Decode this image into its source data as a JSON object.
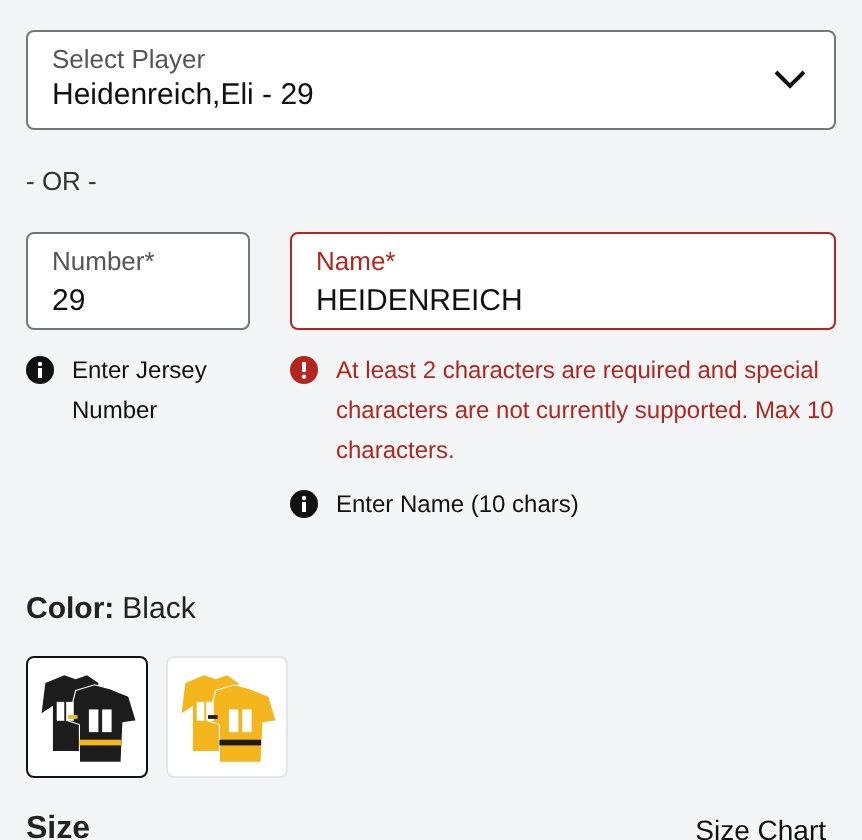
{
  "player_select": {
    "label": "Select Player",
    "value": "Heidenreich,Eli - 29"
  },
  "separator": "- OR -",
  "number_field": {
    "label": "Number*",
    "value": "29",
    "error": false,
    "hint": "Enter Jersey Number"
  },
  "name_field": {
    "label": "Name*",
    "value": "HEIDENREICH",
    "error": true,
    "error_message": "At least 2 characters are required and special characters are not currently supported. Max 10 characters.",
    "hint": "Enter Name (10 chars)"
  },
  "color": {
    "label": "Color:",
    "value": "Black"
  },
  "swatches": [
    {
      "kind": "picture",
      "selected": true,
      "color": "#1c1c1c"
    },
    {
      "kind": "picture",
      "selected": false,
      "color": "#f5b51c"
    }
  ],
  "size": {
    "label": "Size",
    "link": "Size Chart"
  }
}
